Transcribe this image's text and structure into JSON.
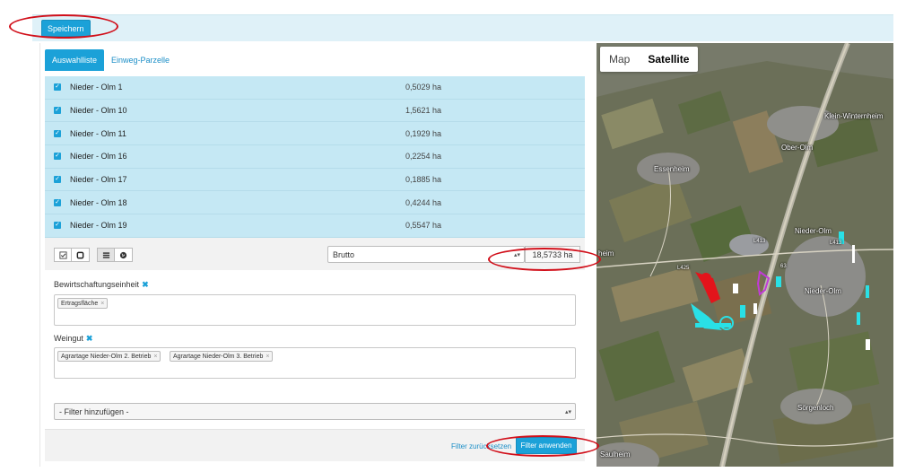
{
  "toolbar": {
    "save_label": "Speichern"
  },
  "tabs": [
    {
      "label": "Auswahlliste",
      "active": true
    },
    {
      "label": "Einweg-Parzelle",
      "active": false
    }
  ],
  "parcels": [
    {
      "name": "Nieder - Olm 1",
      "area": "0,5029 ha",
      "checked": true
    },
    {
      "name": "Nieder - Olm 10",
      "area": "1,5621 ha",
      "checked": true
    },
    {
      "name": "Nieder - Olm 11",
      "area": "0,1929 ha",
      "checked": true
    },
    {
      "name": "Nieder - Olm 16",
      "area": "0,2254 ha",
      "checked": true
    },
    {
      "name": "Nieder - Olm 17",
      "area": "0,1885 ha",
      "checked": true
    },
    {
      "name": "Nieder - Olm 18",
      "area": "0,4244 ha",
      "checked": true
    },
    {
      "name": "Nieder - Olm 19",
      "area": "0,5547 ha",
      "checked": true
    }
  ],
  "list_tools": {
    "icons": [
      "check-all-icon",
      "uncheck-all-icon",
      "list-view-icon",
      "globe-icon"
    ],
    "area_mode": "Brutto",
    "total_area": "18,5733 ha"
  },
  "filters": {
    "bewirtschaftung": {
      "label": "Bewirtschaftungseinheit",
      "tags": [
        "Ertragsfläche"
      ]
    },
    "weingut": {
      "label": "Weingut",
      "tags": [
        "Agrartage Nieder-Olm 2. Betrieb",
        "Agrartage Nieder-Olm 3. Betrieb"
      ]
    },
    "add_placeholder": "- Filter hinzufügen -"
  },
  "footer": {
    "reset_label": "Filter zurücksetzen",
    "apply_label": "Filter anwenden"
  },
  "map": {
    "type_buttons": [
      "Map",
      "Satellite"
    ],
    "selected_type": "Satellite",
    "places": [
      "Ober-Olm",
      "Klein-Winternheim",
      "Essenheim",
      "Nieder-Olm",
      "Nieder-Olm",
      "Sörgenloch",
      "Saulheim",
      "heim"
    ],
    "road_labels": [
      "L413",
      "63",
      "L425",
      "L413"
    ],
    "colors": {
      "accent": "#1ba1d8",
      "highlight": "#d10f1a",
      "map_marker_red": "#e3141b",
      "map_marker_cyan": "#29e0e6",
      "map_marker_magenta": "#c13ad8"
    }
  }
}
